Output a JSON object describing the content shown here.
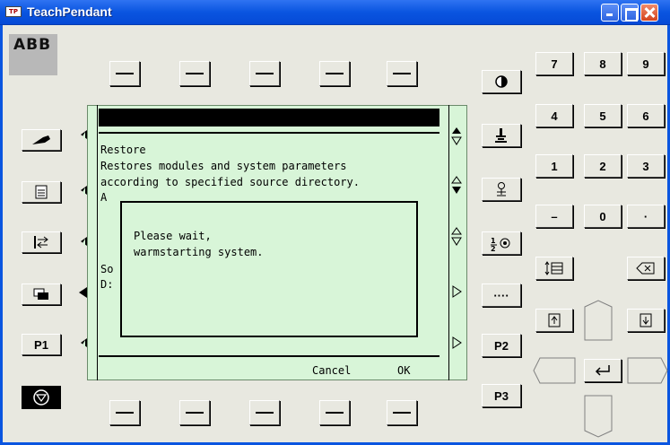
{
  "window": {
    "title": "TeachPendant",
    "app_icon_text": "TP"
  },
  "logo": "ABB",
  "left_buttons": {
    "p1_label": "P1"
  },
  "right_col_buttons": {
    "p2_label": "P2",
    "p3_label": "P3",
    "dots_label": "····"
  },
  "keypad": {
    "row1": [
      "7",
      "8",
      "9"
    ],
    "row2": [
      "4",
      "5",
      "6"
    ],
    "row3": [
      "1",
      "2",
      "3"
    ],
    "row4": [
      "–",
      "0",
      "·"
    ]
  },
  "display": {
    "heading": "Restore",
    "line1": "Restores modules and system parameters",
    "line2": "according to specified source directory.",
    "line3_partial": "A",
    "line_so": "So",
    "line_d": "D:",
    "dialog_line1": "Please wait,",
    "dialog_line2": "warmstarting system.",
    "softkey_cancel": "Cancel",
    "softkey_ok": "OK"
  },
  "icons": {
    "contrast": "contrast-icon",
    "motion": "robot-joint-icon",
    "backspace": "backspace-icon",
    "enter": "enter-icon"
  },
  "colors": {
    "display_bg": "#d8f5d8",
    "titlebar": "#0a55e0",
    "window_bg": "#e8e8e0"
  }
}
